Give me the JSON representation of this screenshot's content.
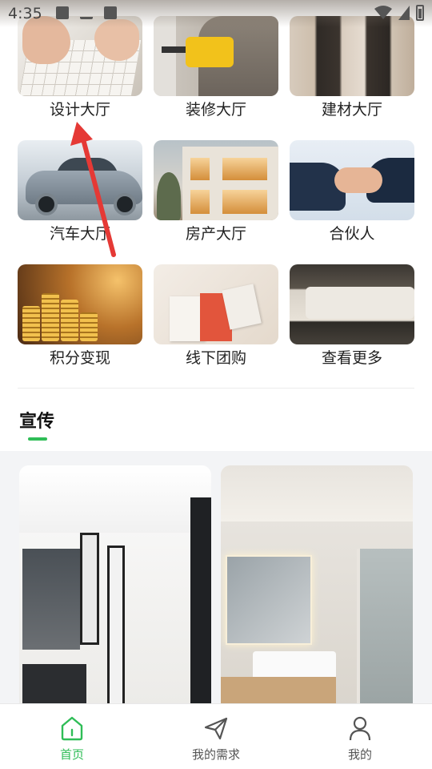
{
  "status_bar": {
    "time": "4:35"
  },
  "categories": [
    {
      "label": "设计大厅",
      "art": "drafting-image"
    },
    {
      "label": "装修大厅",
      "art": "worker-drill-image"
    },
    {
      "label": "建材大厅",
      "art": "material-panels-image"
    },
    {
      "label": "汽车大厅",
      "art": "car-image"
    },
    {
      "label": "房产大厅",
      "art": "house-image"
    },
    {
      "label": "合伙人",
      "art": "handshake-image"
    },
    {
      "label": "积分变现",
      "art": "coins-image"
    },
    {
      "label": "线下团购",
      "art": "shopping-bags-image"
    },
    {
      "label": "查看更多",
      "art": "living-room-image"
    }
  ],
  "promo": {
    "title": "宣传",
    "accent_color": "#2fbd57",
    "cards": [
      {
        "art": "bathroom-doors-image"
      },
      {
        "art": "bathroom-mirror-image"
      }
    ]
  },
  "annotation": {
    "color": "#e53935",
    "kind": "arrow pointing to 设计大厅"
  },
  "bottom_nav": [
    {
      "label": "首页",
      "icon": "home-icon",
      "active": true
    },
    {
      "label": "我的需求",
      "icon": "paper-plane-icon",
      "active": false
    },
    {
      "label": "我的",
      "icon": "user-icon",
      "active": false
    }
  ]
}
